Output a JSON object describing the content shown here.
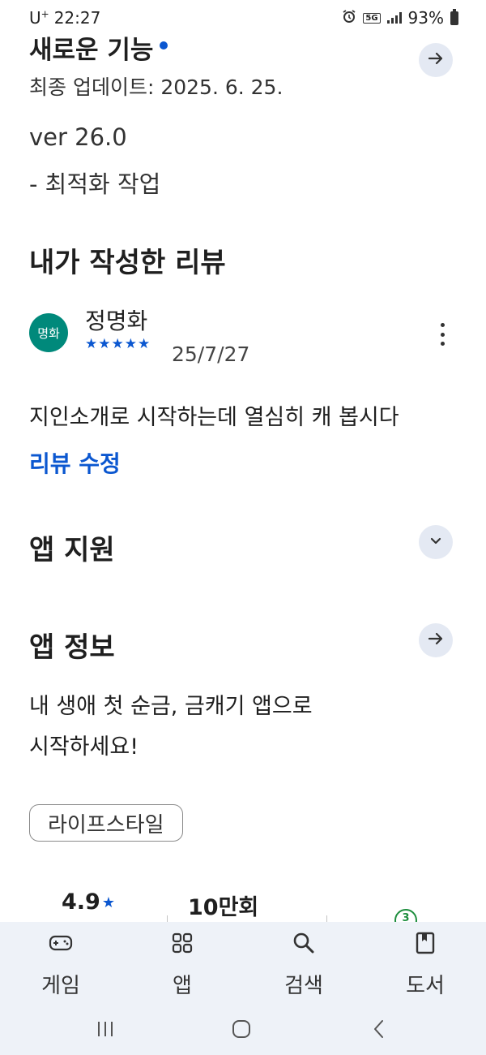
{
  "status_bar": {
    "carrier": "U",
    "carrier_sup": "+",
    "time": "22:27",
    "network": "5G",
    "battery": "93%"
  },
  "whats_new": {
    "title": "새로운 기능",
    "updated": "최종 업데이트: 2025. 6. 25.",
    "version": "ver 26.0",
    "note": "- 최적화 작업"
  },
  "my_review": {
    "title": "내가 작성한 리뷰",
    "avatar_text": "명화",
    "reviewer": "정명화",
    "stars": "★★★★★",
    "rating": 5,
    "date": "25/7/27",
    "text": "지인소개로 시작하는데 열심히 캐 봅시다",
    "edit_label": "리뷰 수정"
  },
  "app_support": {
    "title": "앱 지원"
  },
  "app_info": {
    "title": "앱 정보",
    "description_line1": "내 생애 첫 순금, 금캐기 앱으로",
    "description_line2": "시작하세요!",
    "category": "라이프스타일"
  },
  "stats": {
    "rating": "4.9",
    "rating_star": "★",
    "downloads": "10만회",
    "age_badge": "3"
  },
  "bottom_nav": {
    "items": [
      {
        "label": "게임",
        "icon": "gamepad-icon"
      },
      {
        "label": "앱",
        "icon": "apps-grid-icon"
      },
      {
        "label": "검색",
        "icon": "search-icon"
      },
      {
        "label": "도서",
        "icon": "book-icon"
      }
    ]
  },
  "system_nav": [
    "recent-apps-icon",
    "home-icon",
    "back-icon"
  ],
  "colors": {
    "accent": "#0b57d0",
    "button_bg": "#e4e9f3",
    "nav_bg": "#eef2f8",
    "avatar_bg": "#00897b"
  }
}
